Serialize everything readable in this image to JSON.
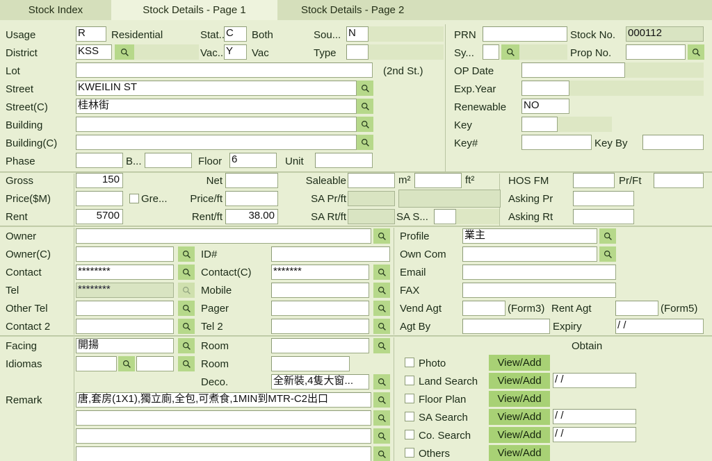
{
  "tabs": [
    {
      "label": "Stock Index",
      "active": false
    },
    {
      "label": "Stock Details - Page 1",
      "active": true
    },
    {
      "label": "Stock Details - Page 2",
      "active": false
    }
  ],
  "left_top": {
    "usage_label": "Usage",
    "usage_code": "R",
    "usage_text": "Residential",
    "stat_label": "Stat...",
    "stat_code": "C",
    "stat_text": "Both",
    "sou_label": "Sou...",
    "sou_code": "N",
    "district_label": "District",
    "district_code": "KSS",
    "vac_label": "Vac...",
    "vac_code": "Y",
    "vac_text": "Vac",
    "type_label": "Type",
    "type_code": "",
    "lot_label": "Lot",
    "lot_value": "",
    "second_st": "(2nd St.)",
    "street_label": "Street",
    "street_value": "KWEILIN ST",
    "street_c_label": "Street(C)",
    "street_c_value": "桂林街",
    "building_label": "Building",
    "building_value": "",
    "building_c_label": "Building(C)",
    "building_c_value": "",
    "phase_label": "Phase",
    "phase_value": "",
    "block_label": "B...",
    "block_value": "",
    "floor_label": "Floor",
    "floor_value": "6",
    "unit_label": "Unit",
    "unit_value": ""
  },
  "right_top": {
    "prn_label": "PRN",
    "prn_value": "",
    "stock_no_label": "Stock No.",
    "stock_no_value": "000112",
    "sy_label": "Sy...",
    "sy_value": "",
    "prop_no_label": "Prop No.",
    "prop_no_value": "",
    "op_date_label": "OP Date",
    "op_date_value": "",
    "exp_year_label": "Exp.Year",
    "exp_year_value": "",
    "renewable_label": "Renewable",
    "renewable_value": "NO",
    "key_label": "Key",
    "key_value": "",
    "key_no_label": "Key#",
    "key_no_value": "",
    "key_by_label": "Key By",
    "key_by_value": ""
  },
  "area_price": {
    "gross_label": "Gross",
    "gross_value": "150",
    "net_label": "Net",
    "net_value": "",
    "saleable_label": "Saleable",
    "saleable_m2_value": "",
    "m2_unit": "m²",
    "saleable_ft2_value": "",
    "ft2_unit": "ft²",
    "hos_fm_label": "HOS FM",
    "hos_fm_value": "",
    "pr_ft_label": "Pr/Ft",
    "pr_ft_value": "",
    "price_label": "Price($M)",
    "price_value": "",
    "gre_label": "Gre...",
    "gre_checked": false,
    "price_ft_label": "Price/ft",
    "price_ft_value": "",
    "sa_pr_ft_label": "SA Pr/ft",
    "sa_pr_ft_value": "",
    "sa_pr_ft_extra": "",
    "asking_pr_label": "Asking Pr",
    "asking_pr_value": "",
    "rent_label": "Rent",
    "rent_value": "5700",
    "rent_ft_label": "Rent/ft",
    "rent_ft_value": "38.00",
    "sa_rt_ft_label": "SA Rt/ft",
    "sa_rt_ft_value": "",
    "sa_s_label": "SA S...",
    "sa_s_value": "",
    "asking_rt_label": "Asking Rt",
    "asking_rt_value": ""
  },
  "contact": {
    "owner_label": "Owner",
    "owner_value": "",
    "owner_c_label": "Owner(C)",
    "owner_c_value": "",
    "id_label": "ID#",
    "id_value": "",
    "contact_label": "Contact",
    "contact_value": "********",
    "contact_c_label": "Contact(C)",
    "contact_c_value": "*******",
    "tel_label": "Tel",
    "tel_value": "********",
    "mobile_label": "Mobile",
    "mobile_value": "",
    "other_tel_label": "Other Tel",
    "other_tel_value": "",
    "pager_label": "Pager",
    "pager_value": "",
    "contact2_label": "Contact 2",
    "contact2_value": "",
    "tel2_label": "Tel 2",
    "tel2_value": ""
  },
  "agent": {
    "profile_label": "Profile",
    "profile_value": "業主",
    "own_com_label": "Own Com",
    "own_com_value": "",
    "email_label": "Email",
    "email_value": "",
    "fax_label": "FAX",
    "fax_value": "",
    "vend_agt_label": "Vend Agt",
    "vend_agt_value": "",
    "form3_label": "(Form3)",
    "rent_agt_label": "Rent Agt",
    "rent_agt_value": "",
    "form5_label": "(Form5)",
    "agt_by_label": "Agt By",
    "agt_by_value": "",
    "expiry_label": "Expiry",
    "expiry_value": "/  /"
  },
  "details": {
    "facing_label": "Facing",
    "facing_value": "開揚",
    "room_label_1": "Room",
    "room_value_1": "",
    "idiomas_label": "Idiomas",
    "idiomas_value_1": "",
    "idiomas_value_2": "",
    "room_label_2": "Room",
    "room_value_2": "",
    "deco_label": "Deco.",
    "deco_value": "全新裝,4隻大窗...",
    "remark_label": "Remark",
    "remark_lines": [
      "唐,套房(1X1),獨立廁,全包,可煮食,1MIN到MTR-C2出口",
      "",
      "",
      ""
    ]
  },
  "obtain": {
    "title": "Obtain",
    "rows": [
      {
        "label": "Photo",
        "checked": false,
        "button": "View/Add",
        "date": null
      },
      {
        "label": "Land Search",
        "checked": false,
        "button": "View/Add",
        "date": "/  /"
      },
      {
        "label": "Floor Plan",
        "checked": false,
        "button": "View/Add",
        "date": null
      },
      {
        "label": "SA Search",
        "checked": false,
        "button": "View/Add",
        "date": "/  /"
      },
      {
        "label": "Co. Search",
        "checked": false,
        "button": "View/Add",
        "date": "/  /"
      },
      {
        "label": "Others",
        "checked": false,
        "button": "View/Add",
        "date": null
      }
    ]
  },
  "icons": {
    "search": "search-icon"
  },
  "colors": {
    "background": "#e8efd4",
    "tab_inactive": "#d5dfbb",
    "tab_active": "#eef3dd",
    "button_green": "#a8d175",
    "magnifier_green": "#b6d88a",
    "disabled_field": "#d9e4c2"
  }
}
